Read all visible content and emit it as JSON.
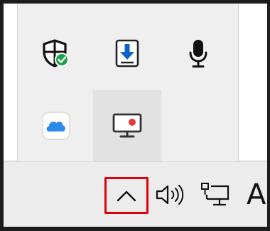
{
  "tray_overflow": {
    "icons": [
      {
        "name": "windows-security-icon"
      },
      {
        "name": "download-update-icon"
      },
      {
        "name": "microphone-icon"
      },
      {
        "name": "icloud-icon"
      },
      {
        "name": "screen-recording-icon"
      }
    ]
  },
  "taskbar": {
    "chevron": {
      "icon": "chevron-up-icon",
      "highlighted": true,
      "highlight_color": "#e0000b"
    },
    "volume": {
      "icon": "speaker-volume-icon"
    },
    "network": {
      "icon": "network-ethernet-icon"
    },
    "language_label": "A"
  },
  "colors": {
    "security_badge": "#1ba24a",
    "download_arrow": "#0b63c9",
    "icloud_blue": "#2d8ae8",
    "recording_dot": "#e43a3a"
  }
}
